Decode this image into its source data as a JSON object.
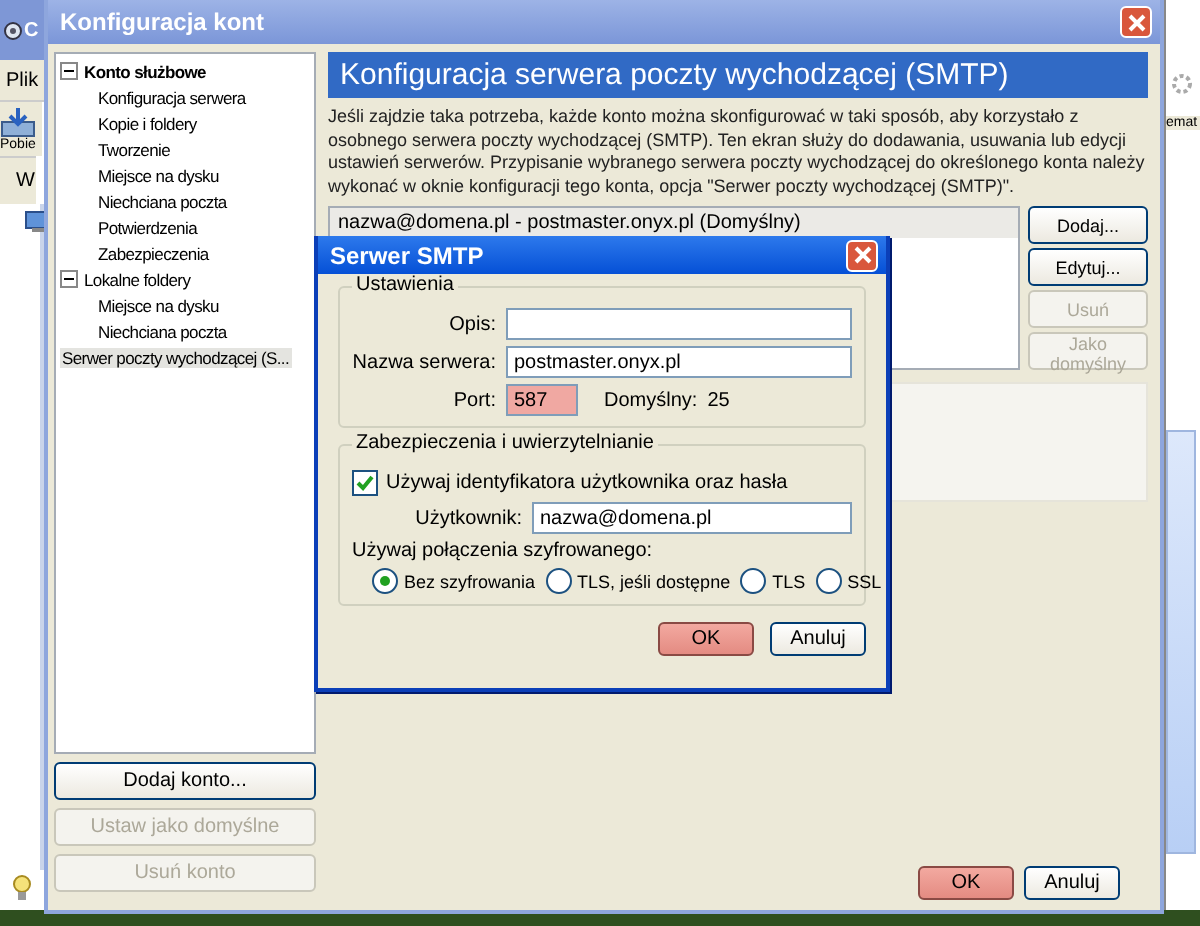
{
  "background_app": {
    "title": "C",
    "menu": [
      "Plik"
    ],
    "toolbar_label": "Pobie",
    "tab_label": "W",
    "column_label": "emat"
  },
  "main_window": {
    "title": "Konfiguracja kont",
    "tree": [
      {
        "label": "Konto służbowe",
        "bold": true,
        "selected": false,
        "expanded": true,
        "children": [
          {
            "label": "Konfiguracja serwera",
            "selected": false
          },
          {
            "label": "Kopie i foldery",
            "selected": false
          },
          {
            "label": "Tworzenie",
            "selected": false
          },
          {
            "label": "Miejsce na dysku",
            "selected": false
          },
          {
            "label": "Niechciana poczta",
            "selected": false
          },
          {
            "label": "Potwierdzenia",
            "selected": false
          },
          {
            "label": "Zabezpieczenia",
            "selected": false
          }
        ]
      },
      {
        "label": "Lokalne foldery",
        "bold": false,
        "selected": false,
        "expanded": true,
        "children": [
          {
            "label": "Miejsce na dysku",
            "selected": false
          },
          {
            "label": "Niechciana poczta",
            "selected": false
          }
        ]
      },
      {
        "label": "Serwer poczty wychodzącej (S...",
        "bold": false,
        "selected": true
      }
    ],
    "account_buttons": [
      {
        "label": "Dodaj konto...",
        "disabled": false
      },
      {
        "label": "Ustaw jako domyślne",
        "disabled": true
      },
      {
        "label": "Usuń konto",
        "disabled": true
      }
    ],
    "section_title": "Konfiguracja serwera poczty wychodzącej (SMTP)",
    "description": "Jeśli zajdzie taka potrzeba, każde konto można skonfigurować w taki sposób, aby korzystało z osobnego serwera poczty wychodzącej (SMTP). Ten ekran służy do dodawania, usuwania lub edycji ustawień serwerów. Przypisanie wybranego serwera poczty wychodzącej do określonego konta należy wykonać w oknie konfiguracji tego konta, opcja \"Serwer poczty wychodzącej (SMTP)\".",
    "servers": [
      {
        "label": "nazwa@domena.pl - postmaster.onyx.pl (Domyślny)",
        "selected": true
      }
    ],
    "server_buttons": [
      {
        "label": "Dodaj...",
        "disabled": false
      },
      {
        "label": "Edytuj...",
        "disabled": false
      },
      {
        "label": "Usuń",
        "disabled": true
      },
      {
        "label": "Jako domyślny",
        "disabled": true
      }
    ],
    "buttons": [
      {
        "label": "OK",
        "highlighted": true
      },
      {
        "label": "Anuluj",
        "highlighted": false
      }
    ]
  },
  "dialog": {
    "title": "Serwer SMTP",
    "settings_group": {
      "legend": "Ustawienia",
      "fields": [
        {
          "label": "Opis:"
        },
        {
          "label": "Nazwa serwera:",
          "value": "postmaster.onyx.pl"
        }
      ],
      "port": {
        "label": "Port:",
        "value": "587",
        "highlighted": true
      },
      "default_label": "Domyślny:",
      "default_value": "25"
    },
    "security_group": {
      "legend": "Zabezpieczenia i uwierzytelnianie",
      "auth_checkbox": {
        "label": "Używaj identyfikatora użytkownika oraz hasła",
        "checked": true
      },
      "user": {
        "label": "Użytkownik:",
        "value": "nazwa@domena.pl"
      },
      "encryption_label": "Używaj połączenia szyfrowanego:",
      "options": [
        {
          "label": "Bez szyfrowania",
          "selected": true
        },
        {
          "label": "TLS, jeśli dostępne",
          "selected": false
        },
        {
          "label": "TLS",
          "selected": false
        },
        {
          "label": "SSL",
          "selected": false
        }
      ]
    },
    "buttons": [
      {
        "label": "OK",
        "highlighted": true
      },
      {
        "label": "Anuluj",
        "highlighted": false
      }
    ]
  }
}
